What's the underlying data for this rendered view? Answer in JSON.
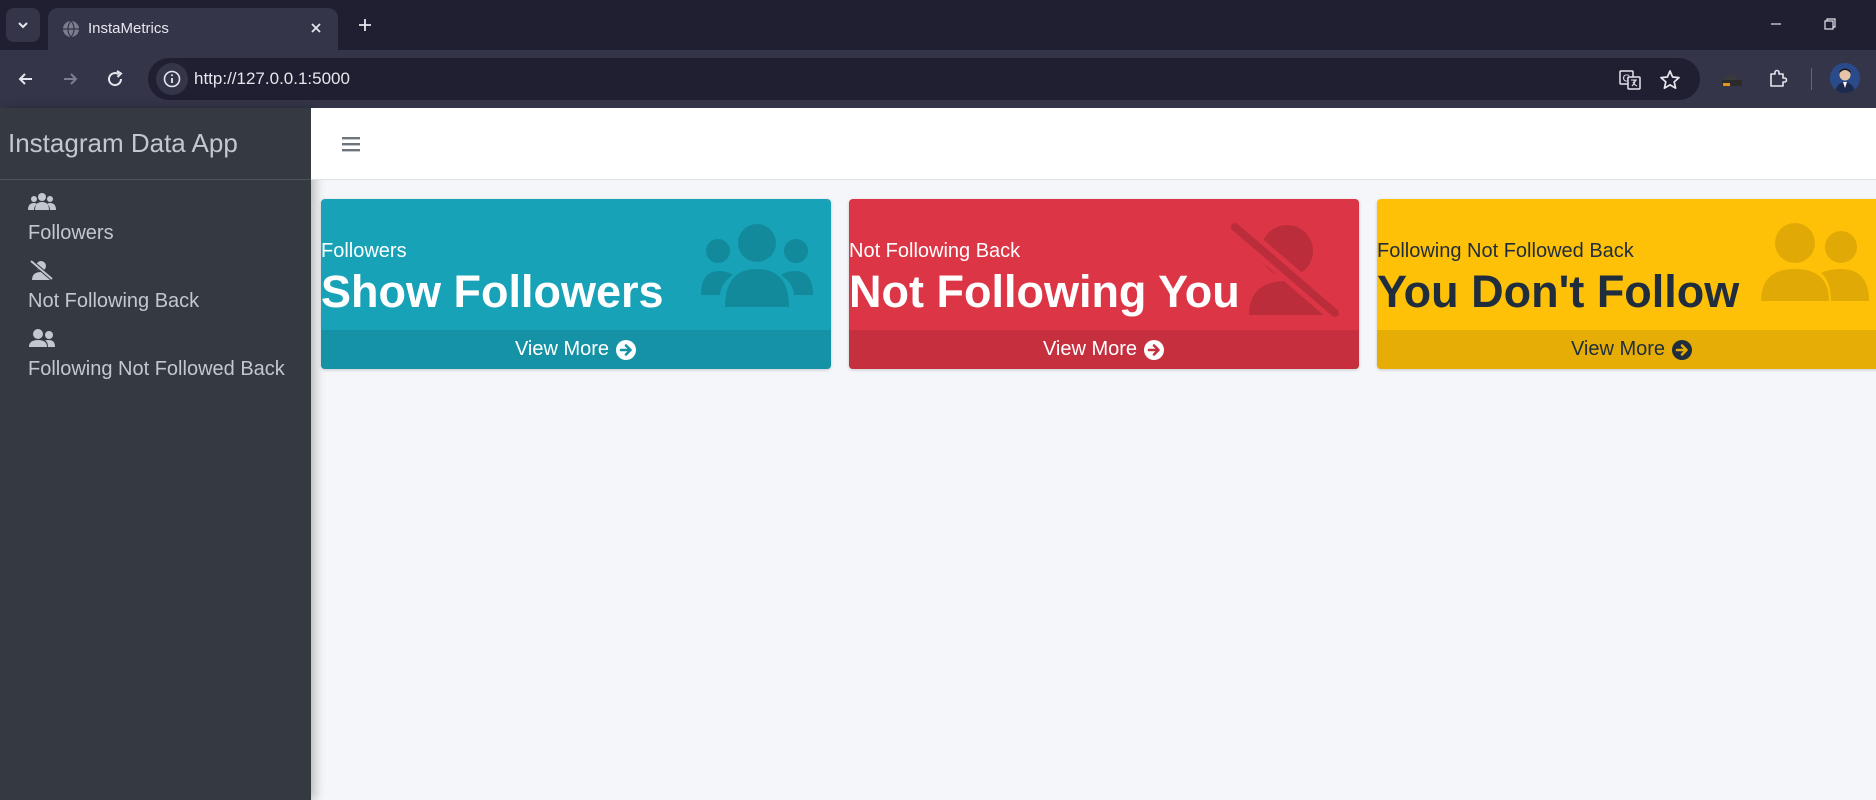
{
  "browser": {
    "tab_title": "InstaMetrics",
    "url": "http://127.0.0.1:5000"
  },
  "sidebar": {
    "brand": "Instagram Data App",
    "items": [
      {
        "label": "Followers",
        "icon": "users-icon"
      },
      {
        "label": "Not Following Back",
        "icon": "user-slash-icon"
      },
      {
        "label": "Following Not Followed Back",
        "icon": "user-friends-icon"
      }
    ]
  },
  "cards": [
    {
      "subtitle": "Followers",
      "title": "Show Followers",
      "footer": "View More",
      "color": "#17a2b8",
      "icon": "users-icon"
    },
    {
      "subtitle": "Not Following Back",
      "title": "Not Following You",
      "footer": "View More",
      "color": "#dc3545",
      "icon": "user-slash-icon"
    },
    {
      "subtitle": "Following Not Followed Back",
      "title": "You Don't Follow",
      "footer": "View More",
      "color": "#ffc107",
      "icon": "user-friends-icon"
    }
  ]
}
